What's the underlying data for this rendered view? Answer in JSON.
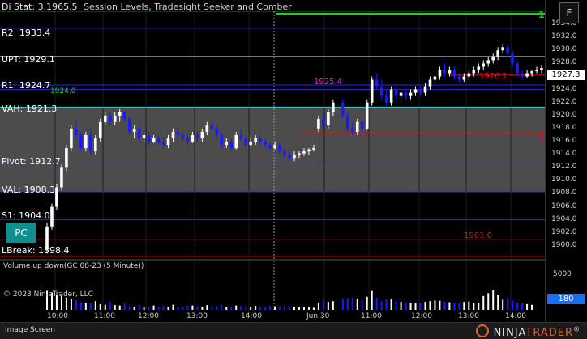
{
  "title": "Session Levels, Tradesight Seeker and Comber",
  "title_prefix": "Di Stat: 3.1965.5",
  "f_button": "F",
  "pc_button": "PC",
  "level_labels": {
    "r2": "R2: 1933.4",
    "upt": "UPT: 1929.1",
    "r1": "R1: 1924.7",
    "vah": "VAH: 1921.3",
    "pivot": "Pivot: 1912.7",
    "val": "VAL: 1908.3",
    "s1": "S1: 1904.0",
    "lbreak": "LBreak: 1898.4"
  },
  "annotations": {
    "teal_1924": "1924.0",
    "red_1901": "1901.0",
    "magenta_1925": "1925.4",
    "red_1926": "1926.1",
    "right_19": "19",
    "right_1": "1"
  },
  "volume_title": "Volume up down(GC 08-23 (5 Minute))",
  "copyright": "© 2023 NinjaTrader, LLC",
  "current_price": "1927.3",
  "current_volume": "180",
  "volume_tick": "5000",
  "yticks": [
    "1934.0",
    "1932.0",
    "1930.0",
    "1928.0",
    "1926.0",
    "1924.0",
    "1922.0",
    "1920.0",
    "1918.0",
    "1916.0",
    "1914.0",
    "1912.0",
    "1910.0",
    "1908.0",
    "1906.0",
    "1904.0",
    "1902.0",
    "1900.0"
  ],
  "xticks": [
    "10:00",
    "11:00",
    "12:00",
    "13:00",
    "14:00",
    "Jun 30",
    "11:00",
    "12:00",
    "13:00",
    "14:00"
  ],
  "footer_left": "Image Screen",
  "brand": {
    "a": "NINJA",
    "b": "TRADER",
    "reg": "®"
  },
  "colors": {
    "up": "#ffffff",
    "down": "#1a1aff",
    "teal": "#19e0d0",
    "green": "#1fcf1f",
    "red": "#e01818",
    "magenta": "#e020c0",
    "blue_line": "#2a2ad8",
    "valuearea": "#595959"
  },
  "chart_data": {
    "type": "candlestick",
    "y_range": [
      1898,
      1936
    ],
    "session_break_after_index": 59,
    "candles": [
      [
        1899.5,
        1903.5,
        1898.8,
        1903.0
      ],
      [
        1903.0,
        1906.5,
        1902.5,
        1906.0
      ],
      [
        1906.0,
        1909.5,
        1905.5,
        1909.0
      ],
      [
        1909.0,
        1912.5,
        1908.5,
        1912.0
      ],
      [
        1912.0,
        1915.5,
        1911.5,
        1915.0
      ],
      [
        1915.0,
        1918.5,
        1914.5,
        1918.0
      ],
      [
        1918.0,
        1919.5,
        1916.5,
        1917.0
      ],
      [
        1917.0,
        1917.5,
        1914.5,
        1915.0
      ],
      [
        1915.0,
        1917.5,
        1914.5,
        1917.0
      ],
      [
        1917.0,
        1918.0,
        1914.0,
        1914.5
      ],
      [
        1914.5,
        1917.0,
        1914.0,
        1916.5
      ],
      [
        1916.5,
        1919.5,
        1916.0,
        1919.0
      ],
      [
        1919.0,
        1920.5,
        1918.5,
        1920.0
      ],
      [
        1920.0,
        1920.5,
        1918.5,
        1919.0
      ],
      [
        1919.0,
        1920.5,
        1918.5,
        1920.0
      ],
      [
        1920.0,
        1921.0,
        1919.0,
        1920.5
      ],
      [
        1920.5,
        1920.8,
        1919.0,
        1919.5
      ],
      [
        1919.5,
        1919.8,
        1917.0,
        1917.5
      ],
      [
        1917.5,
        1918.5,
        1916.5,
        1918.0
      ],
      [
        1918.0,
        1918.5,
        1916.0,
        1916.5
      ],
      [
        1916.5,
        1917.5,
        1916.0,
        1917.0
      ],
      [
        1917.0,
        1917.5,
        1915.5,
        1916.0
      ],
      [
        1916.0,
        1917.0,
        1915.8,
        1916.5
      ],
      [
        1916.5,
        1917.0,
        1915.5,
        1916.0
      ],
      [
        1916.0,
        1916.5,
        1915.0,
        1915.5
      ],
      [
        1915.5,
        1917.0,
        1915.0,
        1916.5
      ],
      [
        1916.5,
        1918.0,
        1916.0,
        1917.5
      ],
      [
        1917.5,
        1918.0,
        1916.5,
        1917.0
      ],
      [
        1917.0,
        1917.5,
        1916.0,
        1916.5
      ],
      [
        1916.5,
        1917.0,
        1915.5,
        1916.0
      ],
      [
        1916.0,
        1917.5,
        1915.8,
        1917.0
      ],
      [
        1917.0,
        1917.5,
        1916.0,
        1916.5
      ],
      [
        1916.5,
        1918.0,
        1916.0,
        1917.5
      ],
      [
        1917.5,
        1919.0,
        1917.0,
        1918.5
      ],
      [
        1918.5,
        1919.0,
        1917.5,
        1918.0
      ],
      [
        1918.0,
        1918.5,
        1916.5,
        1917.0
      ],
      [
        1917.0,
        1917.5,
        1915.0,
        1915.5
      ],
      [
        1915.5,
        1916.5,
        1915.0,
        1916.0
      ],
      [
        1916.0,
        1916.5,
        1914.5,
        1915.0
      ],
      [
        1915.0,
        1917.5,
        1914.8,
        1917.0
      ],
      [
        1917.0,
        1918.0,
        1916.0,
        1916.5
      ],
      [
        1916.5,
        1917.0,
        1915.0,
        1915.5
      ],
      [
        1915.5,
        1916.5,
        1915.2,
        1916.0
      ],
      [
        1916.0,
        1917.0,
        1915.5,
        1916.5
      ],
      [
        1916.5,
        1917.0,
        1915.5,
        1916.0
      ],
      [
        1916.0,
        1916.5,
        1915.0,
        1915.5
      ],
      [
        1915.5,
        1916.0,
        1914.5,
        1915.0
      ],
      [
        1915.0,
        1916.0,
        1914.8,
        1915.5
      ],
      [
        1915.5,
        1916.0,
        1914.0,
        1914.5
      ],
      [
        1914.5,
        1915.0,
        1913.5,
        1914.0
      ],
      [
        1914.0,
        1914.5,
        1913.0,
        1913.5
      ],
      [
        1913.5,
        1914.5,
        1913.0,
        1914.0
      ],
      [
        1914.0,
        1914.5,
        1913.5,
        1914.2
      ],
      [
        1914.2,
        1915.0,
        1913.8,
        1914.5
      ],
      [
        1914.5,
        1915.0,
        1914.0,
        1914.8
      ],
      [
        1914.8,
        1915.5,
        1914.5,
        1915.0
      ],
      [
        1918.0,
        1920.0,
        1917.5,
        1919.5
      ],
      [
        1919.5,
        1920.5,
        1918.0,
        1918.5
      ],
      [
        1918.5,
        1921.0,
        1918.0,
        1920.5
      ],
      [
        1920.5,
        1922.5,
        1920.0,
        1922.0
      ],
      [
        1922.0,
        1922.5,
        1919.5,
        1920.0
      ],
      [
        1920.0,
        1920.5,
        1917.5,
        1918.0
      ],
      [
        1918.0,
        1919.0,
        1917.0,
        1917.5
      ],
      [
        1917.5,
        1919.5,
        1917.0,
        1919.0
      ],
      [
        1919.0,
        1919.5,
        1917.5,
        1918.0
      ],
      [
        1918.0,
        1922.5,
        1917.8,
        1922.0
      ],
      [
        1922.0,
        1926.0,
        1921.5,
        1925.5
      ],
      [
        1925.5,
        1926.5,
        1924.0,
        1924.5
      ],
      [
        1924.5,
        1925.5,
        1922.5,
        1923.0
      ],
      [
        1923.0,
        1924.0,
        1921.5,
        1922.0
      ],
      [
        1922.0,
        1924.5,
        1921.5,
        1924.0
      ],
      [
        1924.0,
        1924.5,
        1922.5,
        1923.0
      ],
      [
        1923.0,
        1924.0,
        1922.0,
        1923.5
      ],
      [
        1923.5,
        1924.0,
        1922.5,
        1923.0
      ],
      [
        1923.0,
        1924.0,
        1922.5,
        1923.5
      ],
      [
        1923.5,
        1924.5,
        1923.0,
        1924.0
      ],
      [
        1924.0,
        1924.5,
        1923.0,
        1923.5
      ],
      [
        1923.5,
        1925.0,
        1923.0,
        1924.5
      ],
      [
        1924.5,
        1926.0,
        1924.0,
        1925.5
      ],
      [
        1925.5,
        1926.5,
        1925.0,
        1926.0
      ],
      [
        1926.0,
        1927.5,
        1925.5,
        1927.0
      ],
      [
        1927.0,
        1928.0,
        1926.0,
        1926.5
      ],
      [
        1926.5,
        1927.5,
        1926.0,
        1927.0
      ],
      [
        1927.0,
        1927.5,
        1925.5,
        1926.0
      ],
      [
        1926.0,
        1926.5,
        1925.0,
        1925.5
      ],
      [
        1925.5,
        1926.5,
        1925.2,
        1926.0
      ],
      [
        1926.0,
        1927.0,
        1925.5,
        1926.5
      ],
      [
        1926.5,
        1927.5,
        1926.0,
        1927.0
      ],
      [
        1927.0,
        1928.0,
        1926.5,
        1927.5
      ],
      [
        1927.5,
        1928.5,
        1927.0,
        1928.0
      ],
      [
        1928.0,
        1929.0,
        1927.5,
        1928.5
      ],
      [
        1928.5,
        1929.5,
        1928.0,
        1929.0
      ],
      [
        1929.0,
        1930.5,
        1928.5,
        1930.0
      ],
      [
        1930.0,
        1931.0,
        1929.5,
        1930.5
      ],
      [
        1930.5,
        1931.0,
        1929.0,
        1929.5
      ],
      [
        1929.5,
        1930.0,
        1927.5,
        1928.0
      ],
      [
        1928.0,
        1928.5,
        1926.0,
        1926.5
      ],
      [
        1926.5,
        1927.0,
        1925.5,
        1926.0
      ],
      [
        1926.0,
        1927.0,
        1925.8,
        1926.5
      ],
      [
        1926.5,
        1927.0,
        1926.0,
        1926.8
      ],
      [
        1926.8,
        1927.5,
        1926.5,
        1927.0
      ],
      [
        1927.0,
        1927.8,
        1926.5,
        1927.3
      ]
    ],
    "volumes": [
      2600,
      2400,
      2100,
      1900,
      1700,
      1500,
      1300,
      1100,
      950,
      900,
      1200,
      800,
      700,
      1100,
      650,
      600,
      900,
      500,
      450,
      700,
      400,
      420,
      600,
      380,
      500,
      450,
      700,
      420,
      380,
      550,
      600,
      480,
      420,
      650,
      500,
      520,
      700,
      450,
      380,
      600,
      520,
      480,
      430,
      560,
      420,
      380,
      520,
      460,
      400,
      600,
      480,
      450,
      380,
      420,
      350,
      300,
      900,
      1300,
      1100,
      1200,
      1500,
      1600,
      1700,
      1450,
      1300,
      1800,
      2600,
      1700,
      1200,
      1400,
      1500,
      1300,
      1100,
      1050,
      950,
      900,
      1000,
      1100,
      1200,
      1300,
      1250,
      1150,
      1050,
      980,
      900,
      1100,
      1150,
      950,
      1000,
      1900,
      2300,
      2700,
      2100,
      1400,
      1700,
      1300,
      1000,
      900,
      800,
      700
    ],
    "levels": [
      {
        "name": "R2",
        "value": 1933.4,
        "color": "#2a2ad8"
      },
      {
        "name": "UPT",
        "value": 1929.1,
        "color": "#8a8a8a"
      },
      {
        "name": "R1",
        "value": 1924.7,
        "color": "#2a2ad8"
      },
      {
        "name": "VAH",
        "value": 1921.3,
        "color": "#19e0d0"
      },
      {
        "name": "Pivot",
        "value": 1912.7,
        "color": "#2a2ad8"
      },
      {
        "name": "VAL",
        "value": 1908.3,
        "color": "#2a2ad8"
      },
      {
        "name": "S1",
        "value": 1904.0,
        "color": "#2a2ad8"
      },
      {
        "name": "LBreak",
        "value": 1898.4,
        "color": "#e01818"
      }
    ]
  }
}
